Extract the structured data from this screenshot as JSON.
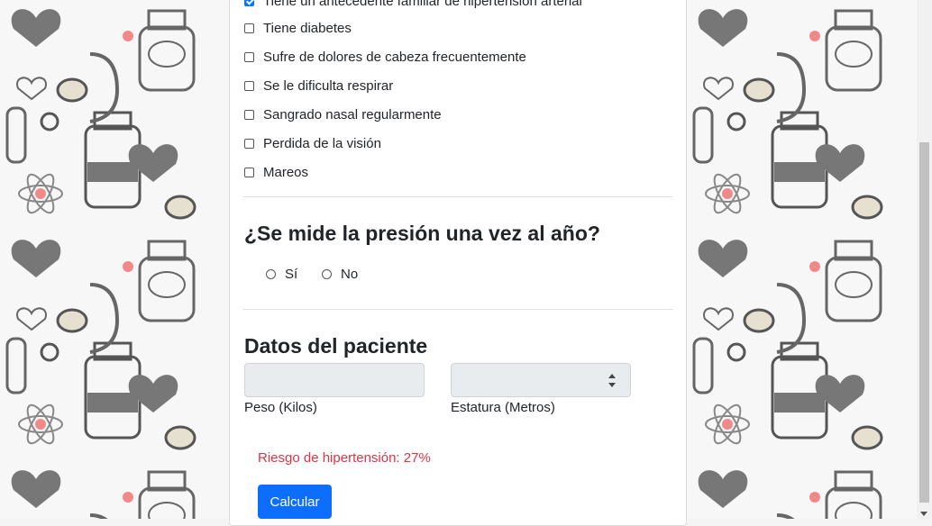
{
  "checklist": [
    {
      "label": "Tiene un antecedente familiar de hipertensión arterial",
      "checked": true
    },
    {
      "label": "Tiene diabetes",
      "checked": false
    },
    {
      "label": "Sufre de dolores de cabeza frecuentemente",
      "checked": false
    },
    {
      "label": "Se le dificulta respirar",
      "checked": false
    },
    {
      "label": "Sangrado nasal regularmente",
      "checked": false
    },
    {
      "label": "Perdida de la visión",
      "checked": false
    },
    {
      "label": "Mareos",
      "checked": false
    }
  ],
  "pressure": {
    "title": "¿Se mide la presión una vez al año?",
    "options": [
      "Sí",
      "No"
    ]
  },
  "patient": {
    "title": "Datos del paciente",
    "weight_label": "Peso (Kilos)",
    "height_label": "Estatura (Metros)",
    "weight_value": "",
    "height_value": ""
  },
  "result": {
    "risk_text": "Riesgo de hipertensión: 27%"
  },
  "actions": {
    "calculate_label": "Calcular"
  },
  "colors": {
    "accent": "#0d6efd",
    "risk": "#dc3545",
    "checked": "#0075ff"
  }
}
